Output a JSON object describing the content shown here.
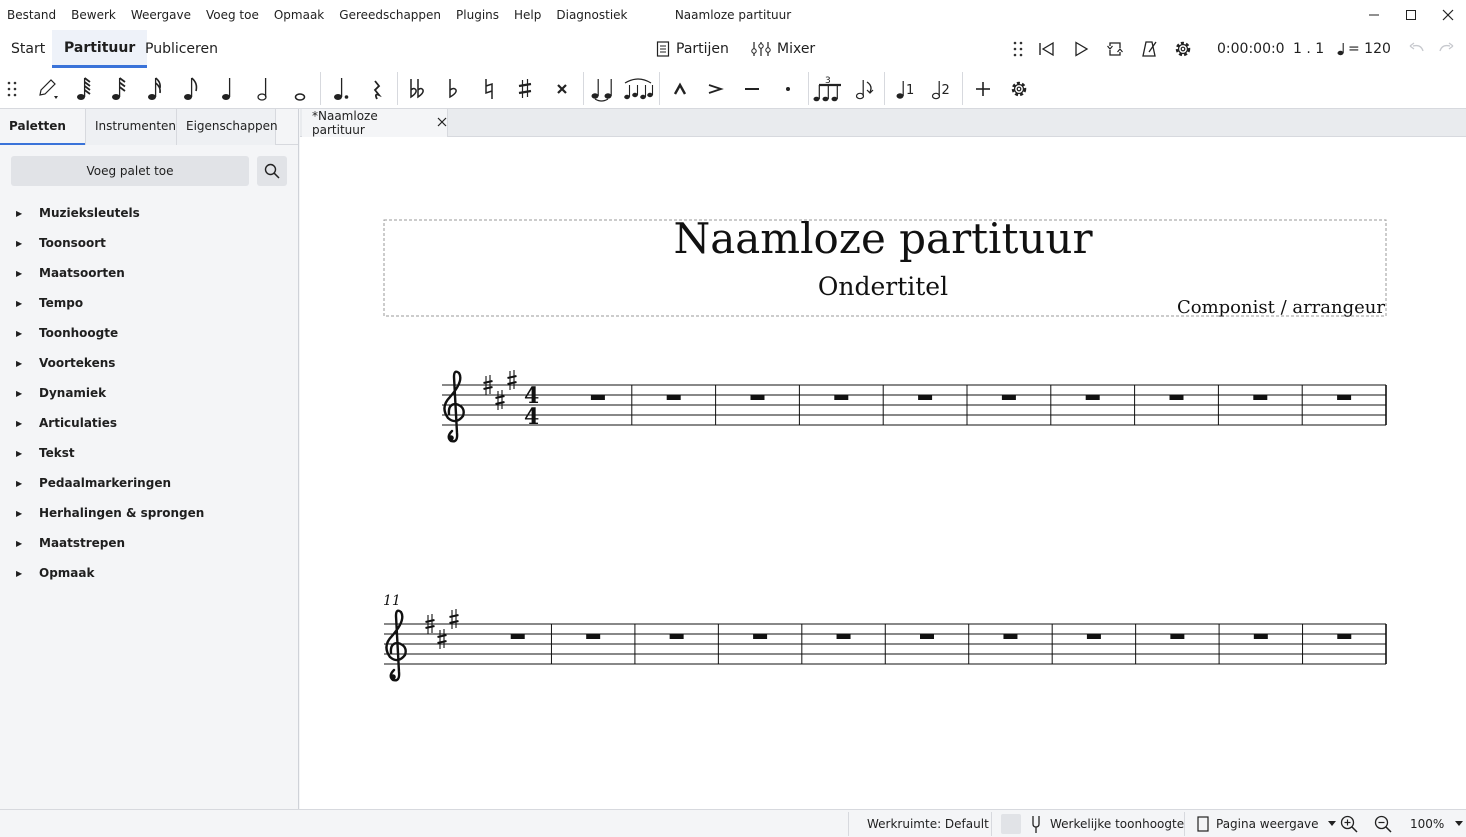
{
  "menubar": {
    "items": [
      "Bestand",
      "Bewerk",
      "Weergave",
      "Voeg toe",
      "Opmaak",
      "Gereedschappen",
      "Plugins",
      "Help",
      "Diagnostiek"
    ],
    "window_title": "Naamloze partituur"
  },
  "top_tabs": {
    "start": "Start",
    "score": "Partituur",
    "publish": "Publiceren"
  },
  "toolbar": {
    "parts_label": "Partijen",
    "mixer_label": "Mixer",
    "time": "0:00:00:0",
    "position": "1 . 1",
    "tempo_value": "= 120"
  },
  "panel": {
    "tabs": [
      "Paletten",
      "Instrumenten",
      "Eigenschappen"
    ],
    "more_dots": "···",
    "add_palette_label": "Voeg palet toe",
    "palettes": [
      "Muzieksleutels",
      "Toonsoort",
      "Maatsoorten",
      "Tempo",
      "Toonhoogte",
      "Voortekens",
      "Dynamiek",
      "Articulaties",
      "Tekst",
      "Pedaalmarkeringen",
      "Herhalingen & sprongen",
      "Maatstrepen",
      "Opmaak"
    ]
  },
  "score_tab": {
    "label": "*Naamloze partituur"
  },
  "score": {
    "title": "Naamloze partituur",
    "subtitle": "Ondertitel",
    "composer": "Componist / arrangeur",
    "time_signature": [
      "4",
      "4"
    ],
    "system2_measure_number": "11",
    "key_sharps": 3,
    "measures_per_system": [
      10,
      11
    ]
  },
  "statusbar": {
    "workspace": "Werkruimte: Default",
    "concert_pitch": "Werkelijke toonhoogte",
    "view_mode": "Pagina weergave",
    "zoom": "100%"
  },
  "colors": {
    "accent": "#3a73d9",
    "canvas": "#ffffff",
    "panel": "#f4f5f7"
  },
  "icons": {
    "note_input_row": [
      "drag-handle-icon",
      "pencil-note-input-icon",
      "64th-note-icon",
      "32nd-note-icon",
      "16th-note-icon",
      "eighth-note-icon",
      "quarter-note-icon",
      "half-note-icon",
      "whole-note-icon",
      "augmentation-dot-icon",
      "rest-icon",
      "double-flat-icon",
      "flat-icon",
      "natural-icon",
      "sharp-icon",
      "double-sharp-icon",
      "tie-icon",
      "slur-icon",
      "marcato-icon",
      "accent-icon",
      "tenuto-icon",
      "staccato-icon",
      "tuplet-icon",
      "flip-direction-icon",
      "voice-1-icon",
      "voice-2-icon",
      "add-icon",
      "customize-icon"
    ]
  }
}
